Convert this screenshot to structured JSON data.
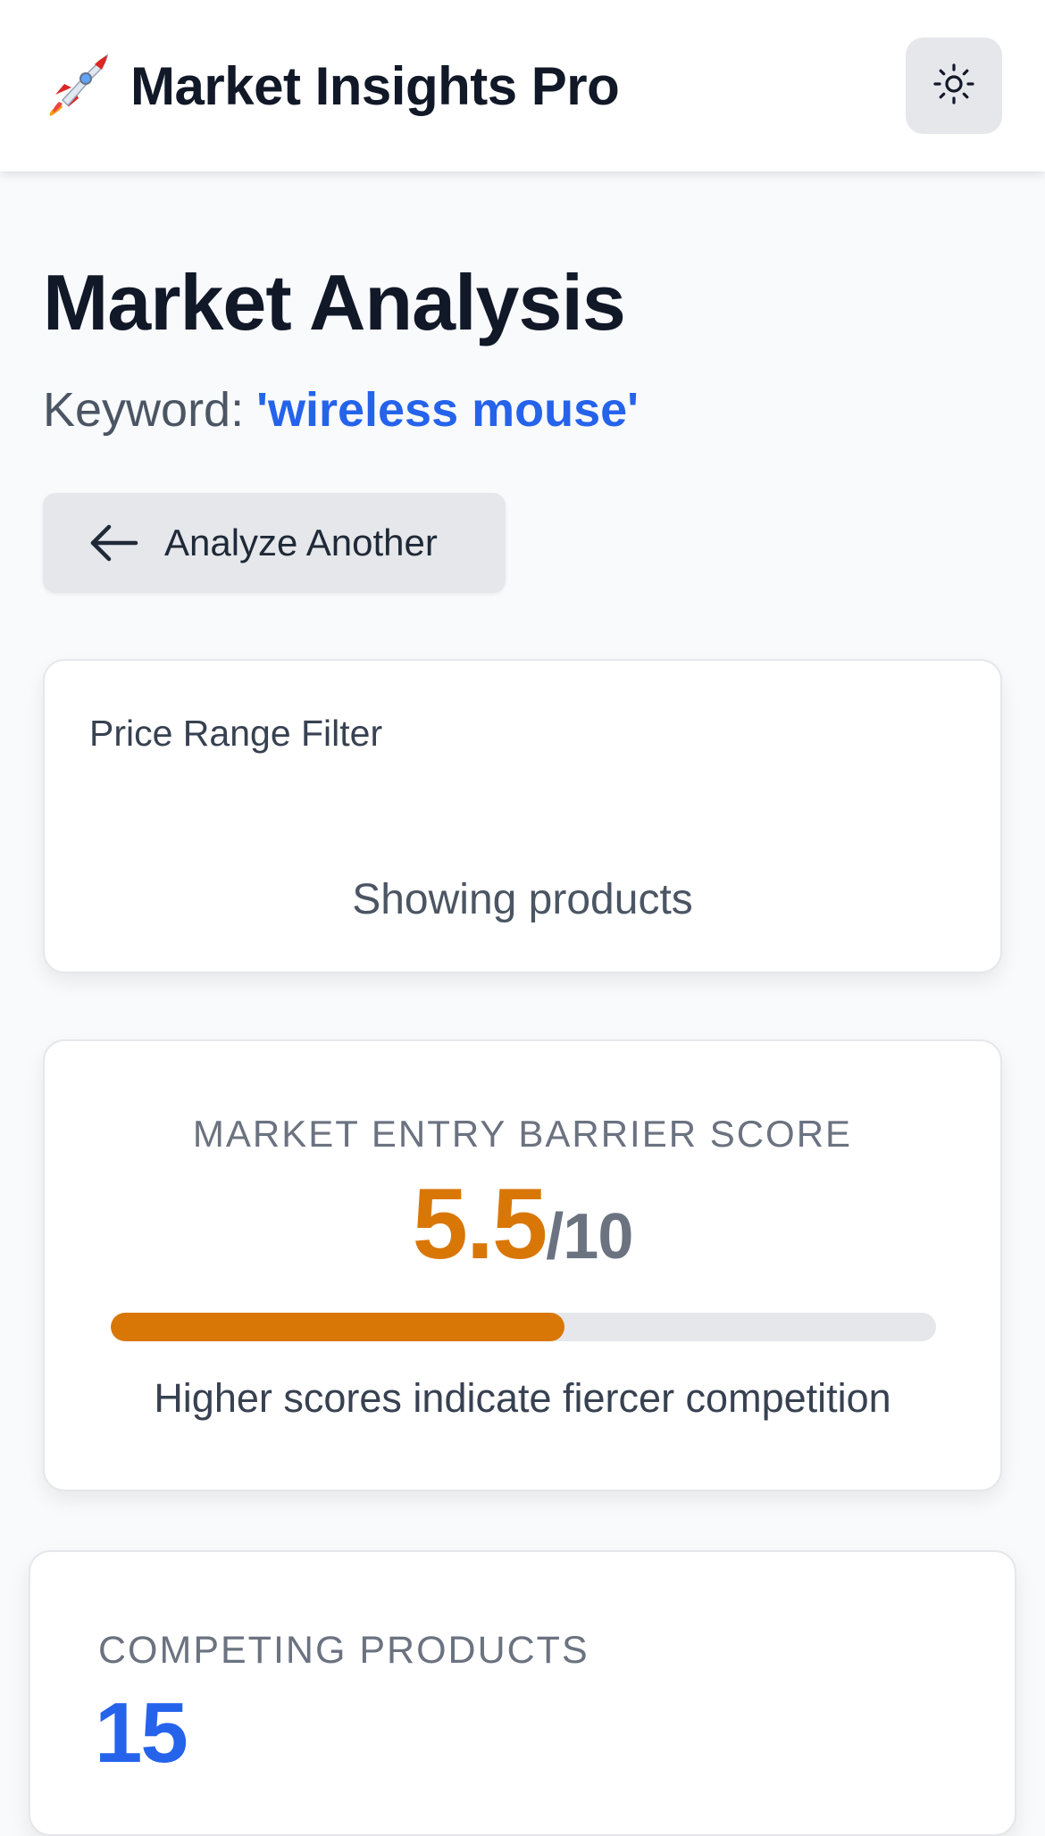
{
  "header": {
    "app_title": "Market Insights Pro",
    "logo_icon": "rocket-icon",
    "theme_toggle_icon": "sun-icon"
  },
  "main": {
    "title": "Market Analysis",
    "keyword_label": "Keyword:",
    "keyword_value": "'wireless mouse'",
    "back_button_label": "Analyze Another",
    "back_button_icon": "arrow-left-icon"
  },
  "price_filter": {
    "title": "Price Range Filter",
    "status": "Showing products"
  },
  "barrier": {
    "label": "MARKET ENTRY BARRIER SCORE",
    "score": "5.5",
    "max": "/10",
    "progress_fraction": 0.55,
    "note": "Higher scores indicate fiercer competition",
    "accent_color": "#d97706"
  },
  "competing": {
    "label": "COMPETING PRODUCTS",
    "value": "15",
    "accent_color": "#2563eb"
  }
}
